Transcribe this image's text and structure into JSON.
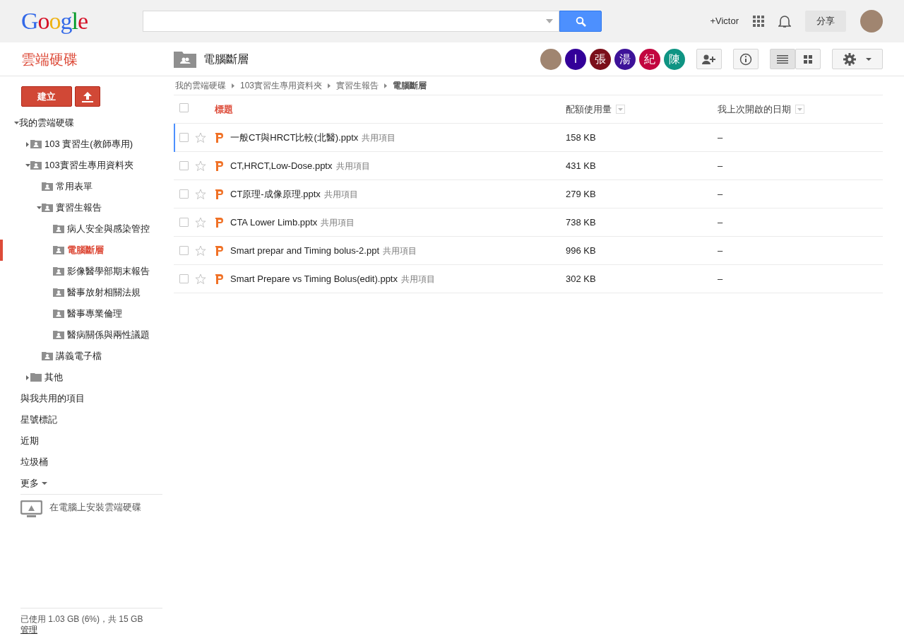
{
  "logo": "Google",
  "account": {
    "name": "+Victor",
    "share": "分享"
  },
  "app_title": "雲端硬碟",
  "folder_title": "電腦斷層",
  "collaborators": [
    {
      "kind": "photo"
    },
    {
      "kind": "initial",
      "initial": "I",
      "color": "#330099"
    },
    {
      "kind": "initial",
      "initial": "張",
      "color": "#7b0f1a"
    },
    {
      "kind": "initial",
      "initial": "湯",
      "color": "#3d1299"
    },
    {
      "kind": "initial",
      "initial": "紀",
      "color": "#c2063f"
    },
    {
      "kind": "initial",
      "initial": "陳",
      "color": "#0f9483"
    }
  ],
  "view_modes": [
    {
      "selected": true
    },
    {
      "selected": false
    }
  ],
  "create_button": "建立",
  "tree": [
    {
      "label": "我的雲端硬碟",
      "expanded": true,
      "selected": false,
      "children": [
        {
          "label": "103 實習生(教師專用)",
          "kind": "shared",
          "expanded": false,
          "selected": false
        },
        {
          "label": "103實習生專用資料夾",
          "kind": "shared",
          "expanded": true,
          "selected": false,
          "children": [
            {
              "label": "常用表單",
              "kind": "shared",
              "selected": false
            },
            {
              "label": "實習生報告",
              "kind": "shared",
              "expanded": true,
              "selected": false,
              "children": [
                {
                  "label": "病人安全與感染管控",
                  "kind": "shared",
                  "selected": false
                },
                {
                  "label": "電腦斷層",
                  "kind": "shared",
                  "selected": true
                },
                {
                  "label": "影像醫學部期末報告",
                  "kind": "shared",
                  "selected": false
                },
                {
                  "label": "醫事放射相關法規",
                  "kind": "shared",
                  "selected": false
                },
                {
                  "label": "醫事專業倫理",
                  "kind": "shared",
                  "selected": false
                },
                {
                  "label": "醫病關係與兩性議題",
                  "kind": "shared",
                  "selected": false
                }
              ]
            },
            {
              "label": "講義電子檔",
              "kind": "shared",
              "selected": false
            }
          ]
        },
        {
          "label": "其他",
          "kind": "folder",
          "expanded": false,
          "selected": false
        }
      ]
    }
  ],
  "nav_items": [
    "與我共用的項目",
    "星號標記",
    "近期",
    "垃圾桶"
  ],
  "more": "更多",
  "install": "在電腦上安裝雲端硬碟",
  "storage": "已使用 1.03 GB (6%)，共 15 GB",
  "manage": "管理",
  "breadcrumb": [
    "我的雲端硬碟",
    "103實習生專用資料夾",
    "實習生報告",
    "電腦斷層"
  ],
  "table": {
    "select_all": {
      "checked": false
    },
    "columns": [
      "標題",
      "配額使用量",
      "我上次開啟的日期"
    ],
    "rows": [
      {
        "name": "一般CT與HRCT比較(北醫).pptx",
        "tag": "共用項目",
        "size": "158 KB",
        "date": "–",
        "focused": true,
        "checked": false,
        "starred": false
      },
      {
        "name": "CT,HRCT,Low-Dose.pptx",
        "tag": "共用項目",
        "size": "431 KB",
        "date": "–",
        "focused": false,
        "checked": false,
        "starred": false
      },
      {
        "name": "CT原理-成像原理.pptx",
        "tag": "共用項目",
        "size": "279 KB",
        "date": "–",
        "focused": false,
        "checked": false,
        "starred": false
      },
      {
        "name": "CTA Lower Limb.pptx",
        "tag": "共用項目",
        "size": "738 KB",
        "date": "–",
        "focused": false,
        "checked": false,
        "starred": false
      },
      {
        "name": "Smart prepar and Timing bolus-2.ppt",
        "tag": "共用項目",
        "size": "996 KB",
        "date": "–",
        "focused": false,
        "checked": false,
        "starred": false
      },
      {
        "name": "Smart Prepare vs Timing Bolus(edit).pptx",
        "tag": "共用項目",
        "size": "302 KB",
        "date": "–",
        "focused": false,
        "checked": false,
        "starred": false
      }
    ]
  }
}
